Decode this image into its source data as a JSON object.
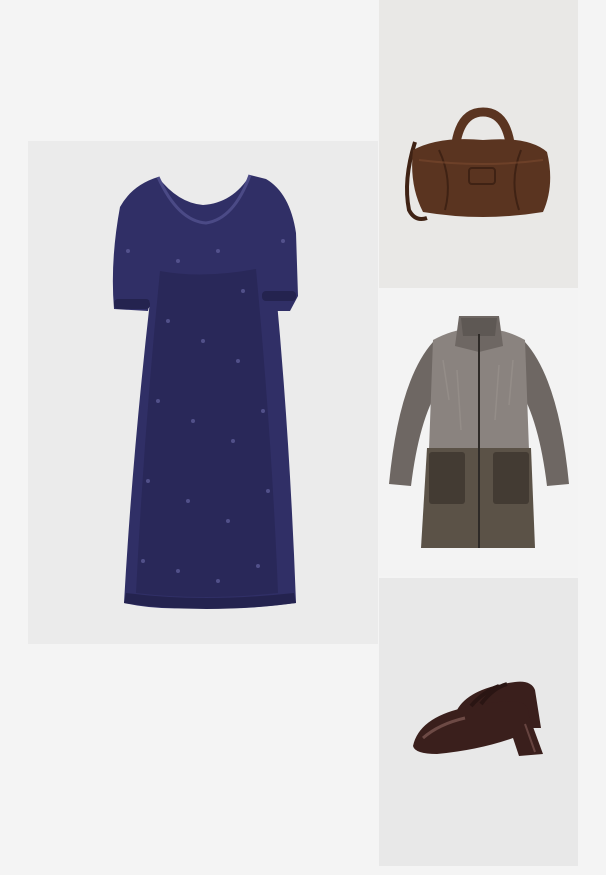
{
  "collage": {
    "background_color": "#f4f4f4",
    "items": [
      {
        "id": "dress",
        "icon": "dress-icon",
        "colors": {
          "main": "#302f66",
          "shade": "#24234f",
          "light": "#4b4a86"
        }
      },
      {
        "id": "bag",
        "icon": "handbag-icon",
        "colors": {
          "main": "#5a3420",
          "shade": "#3f2214",
          "light": "#7a4a2e"
        }
      },
      {
        "id": "coat",
        "icon": "coat-icon",
        "colors": {
          "fur": "#6e6763",
          "fur_light": "#8a837f",
          "leather": "#5b5247",
          "leather_dark": "#433b33"
        }
      },
      {
        "id": "shoes",
        "icon": "shoe-icon",
        "colors": {
          "main": "#3a1f1c",
          "shine": "#7a5550"
        }
      }
    ]
  }
}
